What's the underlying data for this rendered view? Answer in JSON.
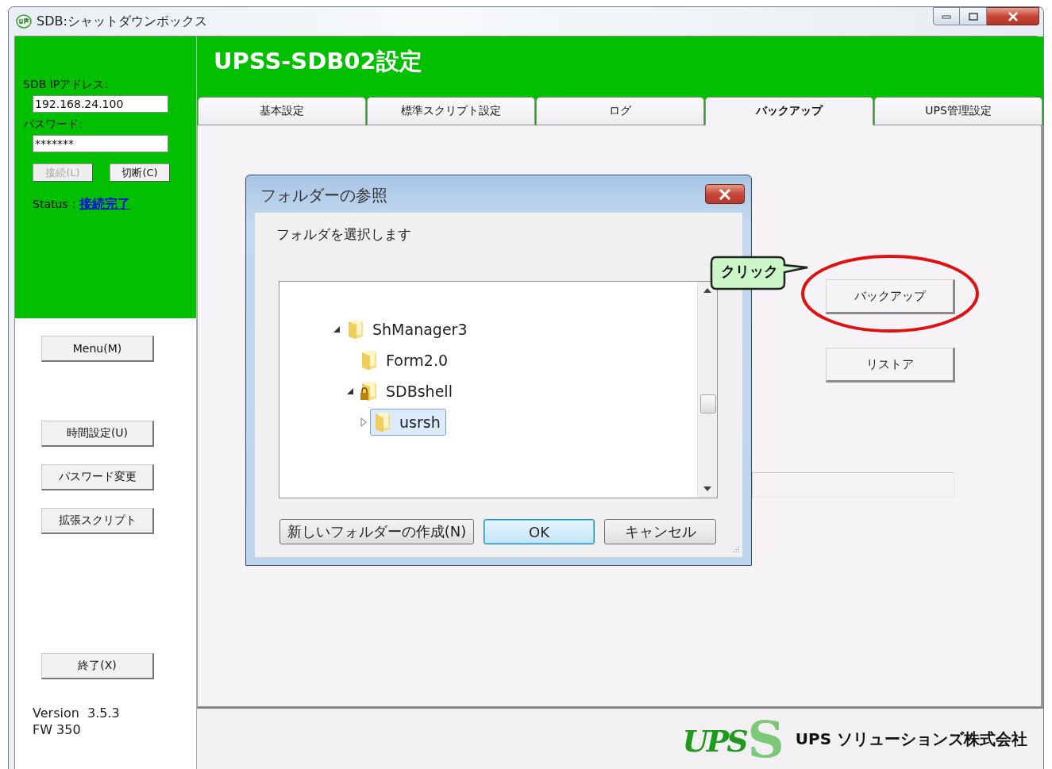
{
  "window": {
    "title": "SDB:シャットダウンボックス"
  },
  "header": {
    "title": "UPSS-SDB02設定"
  },
  "connection": {
    "ip_label": "SDB IPアドレス:",
    "ip_value": "192.168.24.100",
    "password_label": "パスワード:",
    "password_value": "*******",
    "buttons": [
      {
        "label": "接続(L)",
        "disabled": true
      },
      {
        "label": "切断(C)",
        "disabled": false
      }
    ],
    "status_label": "Status：",
    "status_value": "接続完了"
  },
  "side_button_groups": [
    [
      "Menu(M)"
    ],
    [
      "時間設定(U)",
      "パスワード変更",
      "拡張スクリプト"
    ],
    [
      "終了(X)"
    ]
  ],
  "version": [
    "Version  3.5.3",
    "FW 350"
  ],
  "tabs": [
    {
      "label": "基本設定",
      "selected": false
    },
    {
      "label": "標準スクリプト設定",
      "selected": false
    },
    {
      "label": "ログ",
      "selected": false
    },
    {
      "label": "バックアップ",
      "selected": true
    },
    {
      "label": "UPS管理設定",
      "selected": false
    }
  ],
  "backup_panel": {
    "buttons": [
      "バックアップ",
      "リストア"
    ]
  },
  "dialog": {
    "title": "フォルダーの参照",
    "prompt": "フォルダを選択します",
    "tree": [
      {
        "label": "ShManager3",
        "expandable": true,
        "expanded": true,
        "selected": false,
        "locked": false,
        "children": [
          {
            "label": "Form2.0",
            "expandable": false,
            "selected": false,
            "locked": false
          },
          {
            "label": "SDBshell",
            "expandable": true,
            "expanded": true,
            "selected": false,
            "locked": true,
            "children": [
              {
                "label": "usrsh",
                "expandable": true,
                "expanded": false,
                "selected": true,
                "locked": false
              }
            ]
          }
        ]
      }
    ],
    "buttons": [
      {
        "label": "新しいフォルダーの作成(N)",
        "default": false
      },
      {
        "label": "OK",
        "default": true
      },
      {
        "label": "キャンセル",
        "default": false
      }
    ]
  },
  "callout": {
    "text": "クリック"
  },
  "footer": {
    "logo_text": "UPS",
    "logo_backdrop": "S",
    "company": "UPS ソリューションズ株式会社"
  }
}
